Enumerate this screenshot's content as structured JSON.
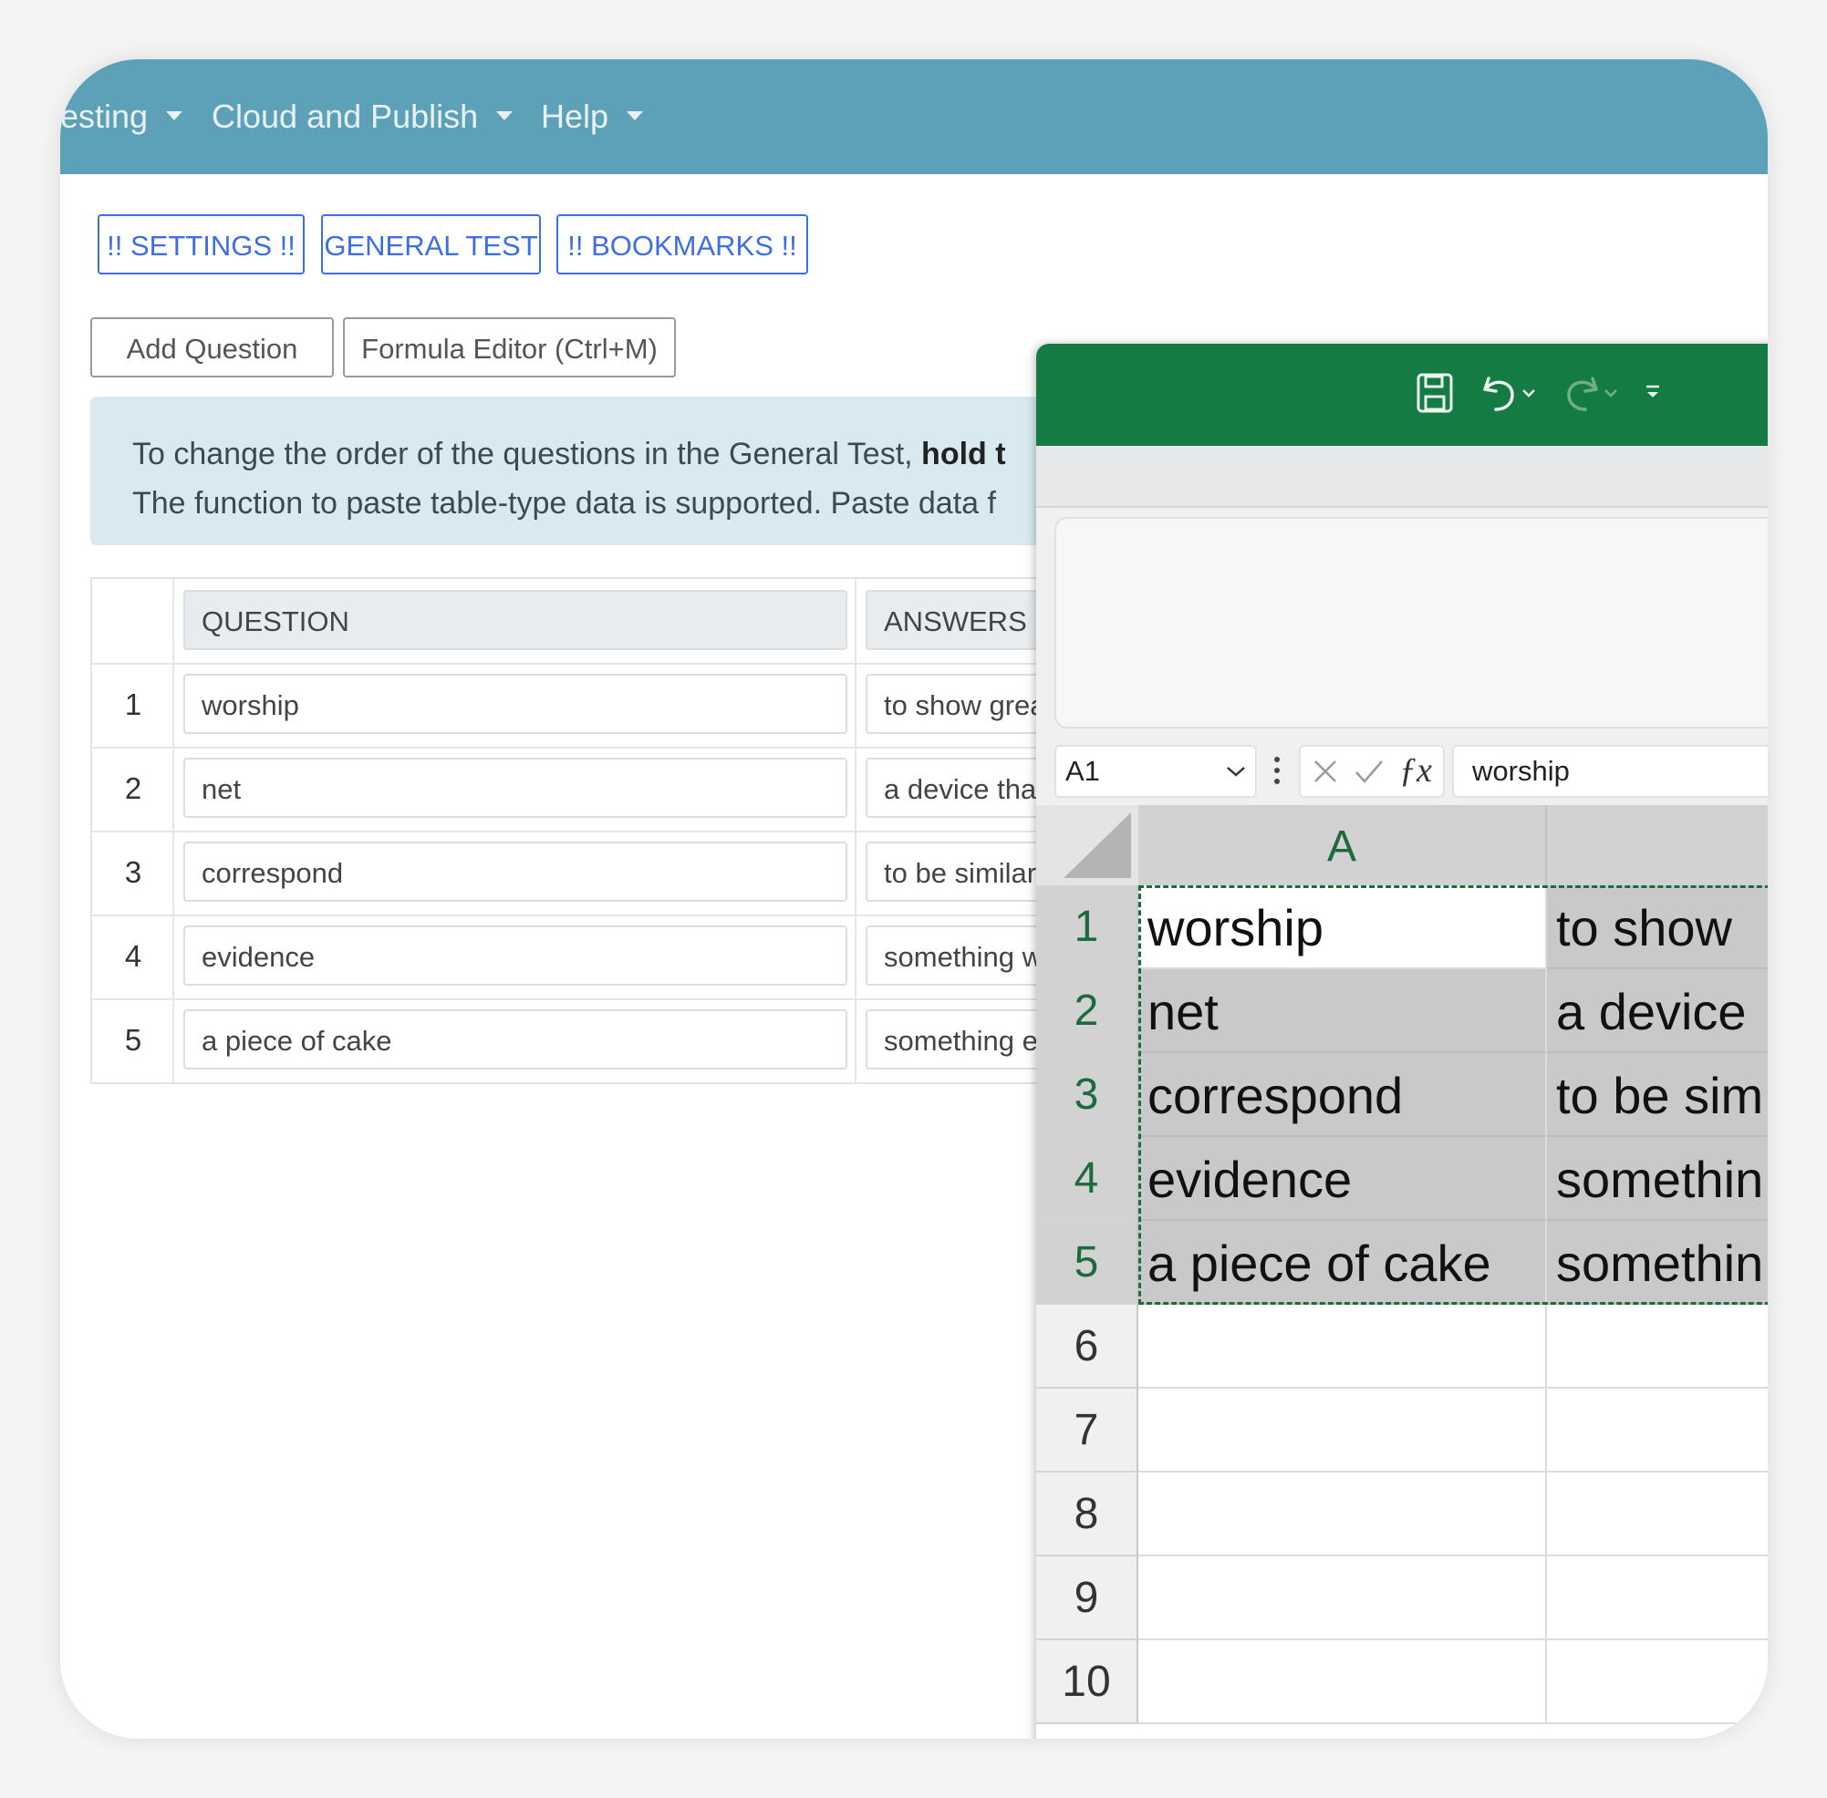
{
  "nav": {
    "items": [
      {
        "label": "esting"
      },
      {
        "label": "Cloud and Publish"
      },
      {
        "label": "Help"
      }
    ]
  },
  "tabs": {
    "settings": "!! SETTINGS !!",
    "general_test": "GENERAL TEST",
    "bookmarks": "!! BOOKMARKS !!"
  },
  "actions": {
    "add_question": "Add Question",
    "formula_editor": "Formula Editor (Ctrl+M)"
  },
  "info": {
    "line1_prefix": "To change the order of the questions in the General Test, ",
    "line1_bold": "hold t",
    "line2": "The function to paste table-type data is supported. Paste data f"
  },
  "question_table": {
    "headers": {
      "question": "QUESTION",
      "answers": "ANSWERS (S"
    },
    "rows": [
      {
        "num": "1",
        "question": "worship",
        "answer": "to show grea"
      },
      {
        "num": "2",
        "question": "net",
        "answer": "a device tha"
      },
      {
        "num": "3",
        "question": "correspond",
        "answer": "to be similar"
      },
      {
        "num": "4",
        "question": "evidence",
        "answer": "something w"
      },
      {
        "num": "5",
        "question": "a piece of cake",
        "answer": "something e"
      }
    ]
  },
  "excel": {
    "name_box": "A1",
    "formula_value": "worship",
    "column_a": "A",
    "rows": [
      {
        "num": "1",
        "a": "worship",
        "b": "to show"
      },
      {
        "num": "2",
        "a": "net",
        "b": "a device"
      },
      {
        "num": "3",
        "a": "correspond",
        "b": "to be sim"
      },
      {
        "num": "4",
        "a": "evidence",
        "b": "somethin"
      },
      {
        "num": "5",
        "a": "a piece of cake",
        "b": "somethin"
      },
      {
        "num": "6",
        "a": "",
        "b": ""
      },
      {
        "num": "7",
        "a": "",
        "b": ""
      },
      {
        "num": "8",
        "a": "",
        "b": ""
      },
      {
        "num": "9",
        "a": "",
        "b": ""
      },
      {
        "num": "10",
        "a": "",
        "b": ""
      }
    ]
  },
  "colors": {
    "nav_bg": "#5da1b8",
    "excel_green": "#147c42",
    "link_blue": "#3d6ee8",
    "info_bg": "#d8eaf0"
  }
}
